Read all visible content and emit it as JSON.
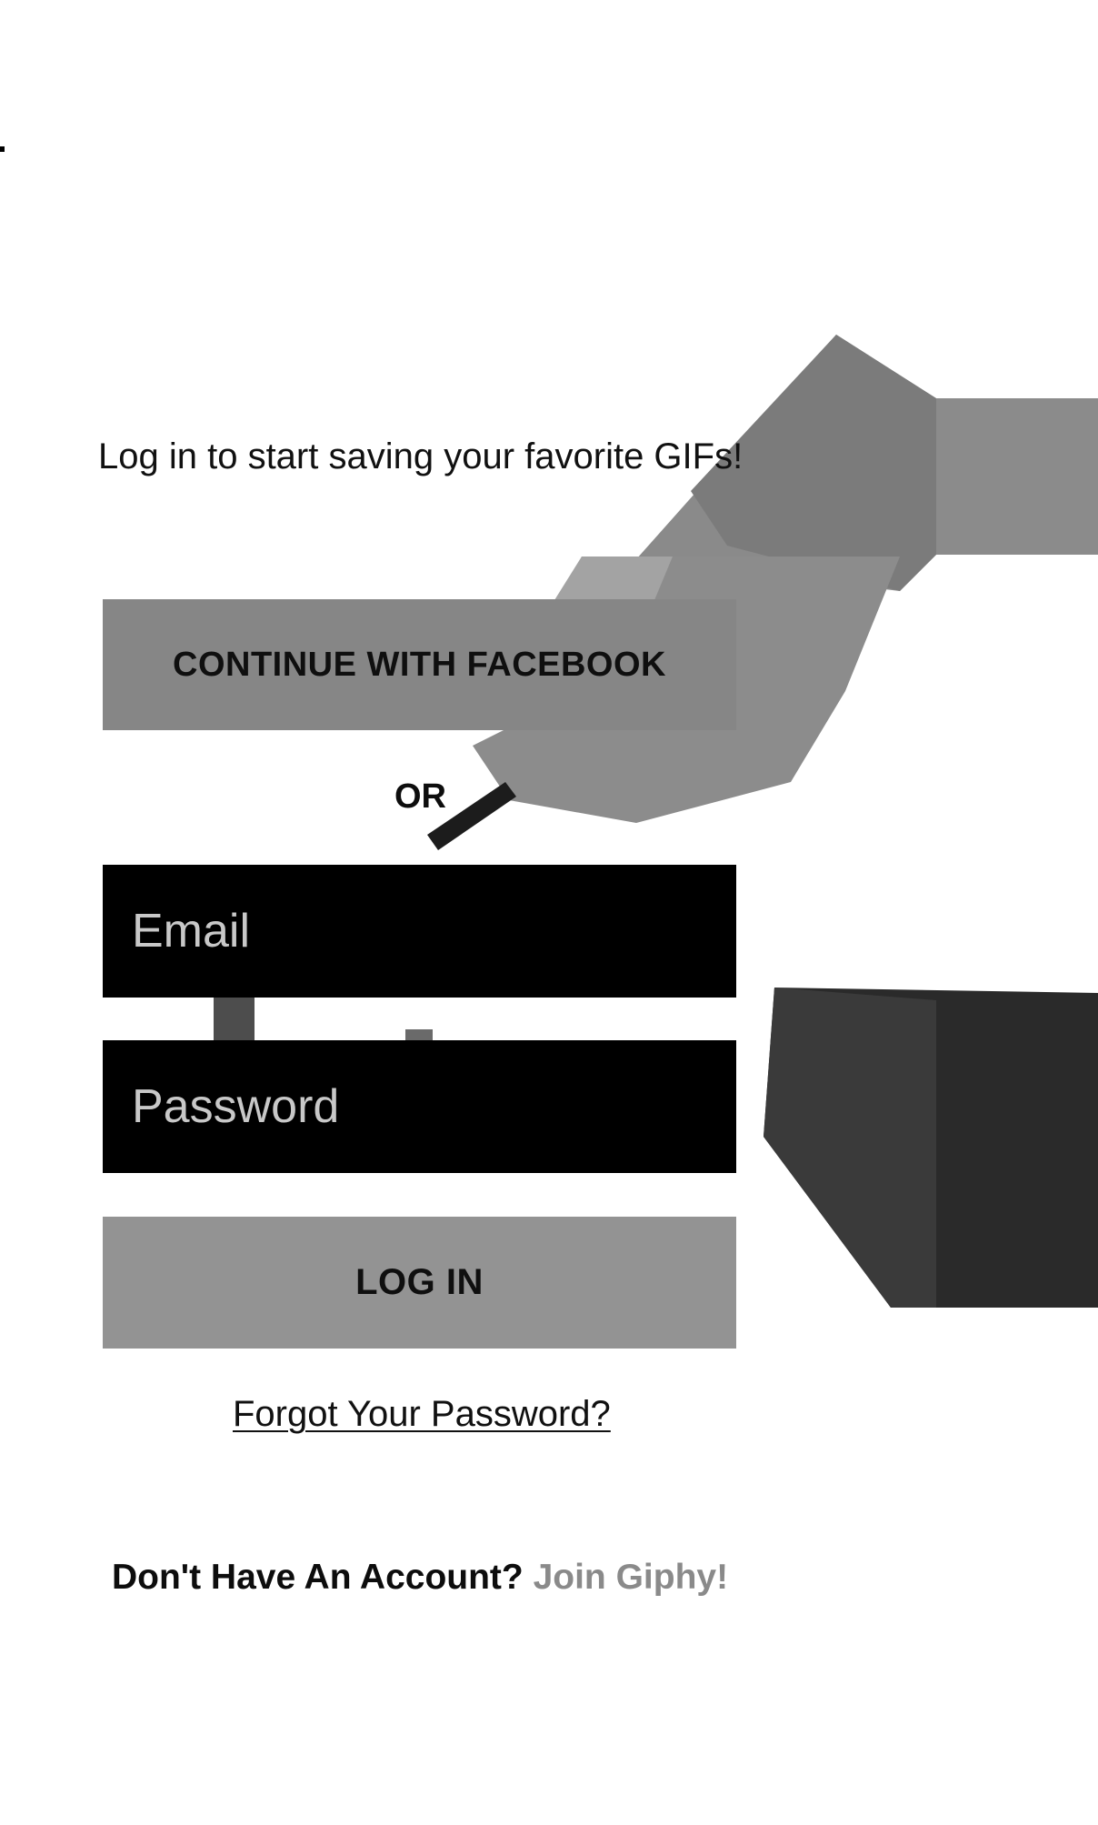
{
  "colors": {
    "background": "#ffffff",
    "button_fill": "#8f8f8f",
    "input_fill": "#000000",
    "join_link": "#8a8a8a",
    "text": "#111111"
  },
  "login": {
    "tagline": "Log in to start saving your favorite GIFs!",
    "facebook_button_label": "CONTINUE WITH FACEBOOK",
    "or_separator": "OR",
    "email_placeholder": "Email",
    "password_placeholder": "Password",
    "login_button_label": "LOG IN",
    "forgot_password_link": "Forgot Your Password?",
    "signup_prompt": "Don't Have An Account?",
    "signup_link": "Join Giphy!"
  },
  "icons": [
    "status-indicator-icon"
  ]
}
